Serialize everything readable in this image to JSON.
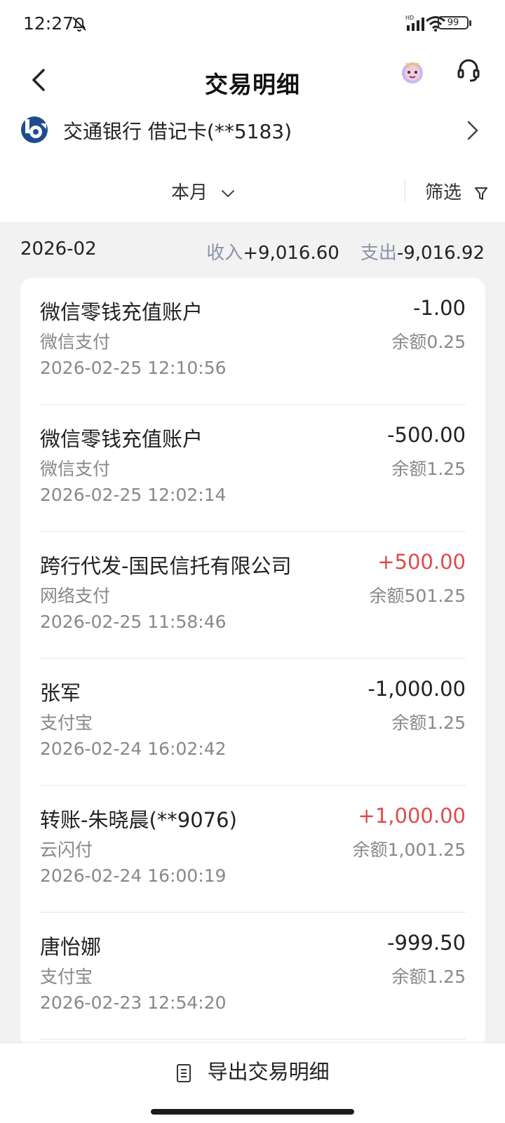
{
  "status_bar": {
    "time": "12:27",
    "battery": "99",
    "network": "HD"
  },
  "header": {
    "title": "交易明细"
  },
  "card": {
    "name": "交通银行 借记卡(**5183)"
  },
  "filter": {
    "period": "本月",
    "filter_label": "筛选"
  },
  "summary": {
    "month": "2026-02",
    "income_label": "收入",
    "income_value": "+9,016.60",
    "expense_label": "支出",
    "expense_value": "-9,016.92"
  },
  "transactions": [
    {
      "name": "微信零钱充值账户",
      "amount": "-1.00",
      "channel": "微信支付",
      "balance": "余额0.25",
      "time": "2026-02-25 12:10:56",
      "direction": "out"
    },
    {
      "name": "微信零钱充值账户",
      "amount": "-500.00",
      "channel": "微信支付",
      "balance": "余额1.25",
      "time": "2026-02-25 12:02:14",
      "direction": "out"
    },
    {
      "name": "跨行代发-国民信托有限公司",
      "amount": "+500.00",
      "channel": "网络支付",
      "balance": "余额501.25",
      "time": "2026-02-25 11:58:46",
      "direction": "in"
    },
    {
      "name": "张军",
      "amount": "-1,000.00",
      "channel": "支付宝",
      "balance": "余额1.25",
      "time": "2026-02-24 16:02:42",
      "direction": "out"
    },
    {
      "name": "转账-朱晓晨(**9076)",
      "amount": "+1,000.00",
      "channel": "云闪付",
      "balance": "余额1,001.25",
      "time": "2026-02-24 16:00:19",
      "direction": "in"
    },
    {
      "name": "唐怡娜",
      "amount": "-999.50",
      "channel": "支付宝",
      "balance": "余额1.25",
      "time": "2026-02-23 12:54:20",
      "direction": "out"
    }
  ],
  "footer": {
    "export_label": "导出交易明细"
  },
  "colors": {
    "income": "#e04b4b",
    "label_gray": "#8a94a6",
    "brand_blue": "#1d4c8f"
  },
  "icons": [
    "bell-muted-icon",
    "signal-icon",
    "wifi-icon",
    "battery-icon",
    "back-arrow-icon",
    "mascot-icon",
    "headset-icon",
    "bank-logo-icon",
    "chevron-right-icon",
    "chevron-down-icon",
    "funnel-icon",
    "document-icon"
  ]
}
